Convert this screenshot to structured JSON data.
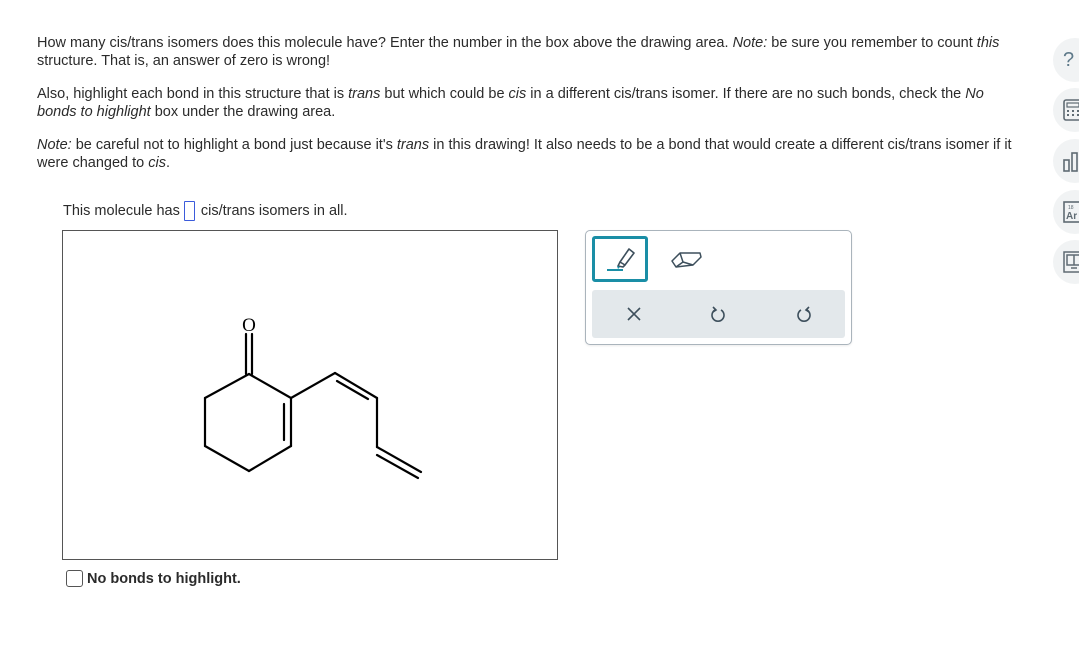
{
  "question": {
    "p1": [
      "How many cis/trans isomers does this molecule have? Enter the number in the box above the drawing area. ",
      "Note:",
      " be sure you remember to count ",
      "this",
      " structure. That is, an answer of zero is wrong!"
    ],
    "p2": [
      "Also, highlight each bond in this structure that is ",
      "trans",
      " but which could be ",
      "cis",
      " in a different cis/trans isomer. If there are no such bonds, check the ",
      "No bonds to highlight",
      " box under the drawing area."
    ],
    "p3": [
      "Note:",
      " be careful not to highlight a bond just because it's ",
      "trans",
      " in this drawing! It also needs to be a bond that would create a different cis/trans isomer if it were changed to ",
      "cis",
      "."
    ]
  },
  "answer": {
    "prefix": "This molecule has",
    "value": "",
    "suffix": "cis/trans isomers in all."
  },
  "molecule": {
    "atom_label": "O"
  },
  "no_bonds": {
    "label": "No bonds to highlight.",
    "checked": false
  },
  "toolbox": {
    "tools": [
      {
        "name": "highlight",
        "icon": "highlighter-icon",
        "selected": true
      },
      {
        "name": "eraser",
        "icon": "eraser-icon",
        "selected": false
      }
    ],
    "actions": [
      {
        "name": "clear",
        "icon": "close-icon"
      },
      {
        "name": "undo",
        "icon": "undo-icon"
      },
      {
        "name": "redo",
        "icon": "redo-icon"
      }
    ],
    "accent_color": "#1a8ea6"
  },
  "sidebar": {
    "items": [
      {
        "name": "help",
        "icon": "question-icon",
        "glyph": "?"
      },
      {
        "name": "calculator",
        "icon": "calculator-icon"
      },
      {
        "name": "data",
        "icon": "bar-chart-icon"
      },
      {
        "name": "periodic-table",
        "icon": "periodic-table-icon",
        "glyph": "Ar",
        "number": "18"
      },
      {
        "name": "reference",
        "icon": "reference-book-icon"
      }
    ]
  }
}
